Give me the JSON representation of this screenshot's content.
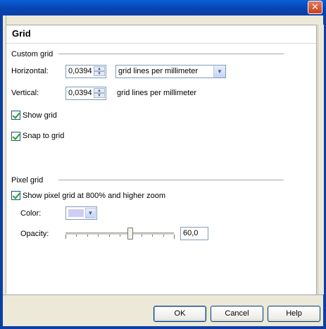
{
  "window": {
    "close_glyph": "✕"
  },
  "page": {
    "title": "Grid"
  },
  "custom_grid": {
    "section_label": "Custom grid",
    "horizontal": {
      "label": "Horizontal:",
      "value": "0,0394",
      "unit_selected": "grid lines per millimeter"
    },
    "vertical": {
      "label": "Vertical:",
      "value": "0,0394",
      "unit_text": "grid lines per millimeter"
    },
    "show_grid": {
      "label": "Show grid",
      "checked": true
    },
    "snap_to_grid": {
      "label": "Snap to grid",
      "checked": true
    }
  },
  "pixel_grid": {
    "section_label": "Pixel grid",
    "show_pixel_grid": {
      "label": "Show pixel grid at 800% and higher zoom",
      "checked": true
    },
    "color": {
      "label": "Color:",
      "value": "#cfcdf4"
    },
    "opacity": {
      "label": "Opacity:",
      "value": "60,0",
      "fraction": 0.6
    }
  },
  "footer": {
    "ok": "OK",
    "cancel": "Cancel",
    "help": "Help"
  },
  "colors": {
    "title_bar": "#0a5fd8",
    "close_button": "#c8411d",
    "checkmark": "#21a121"
  }
}
